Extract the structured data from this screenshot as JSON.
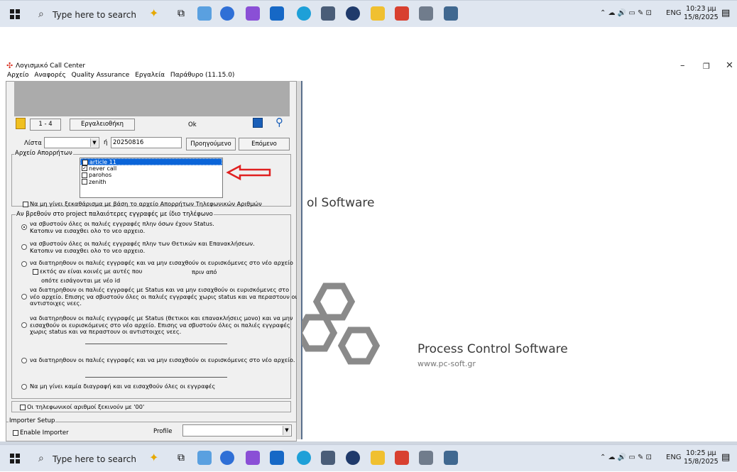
{
  "taskbar": {
    "search_placeholder": "Type here to search",
    "lang": "ENG",
    "top_time": "10:23 μμ",
    "top_date": "15/8/2025",
    "bottom_time": "10:25 μμ",
    "bottom_date": "15/8/2025"
  },
  "window": {
    "title": "Λογισμικό Call Center",
    "menu": [
      "Αρχείο",
      "Αναφορές",
      "Quality Assurance",
      "Εργαλεία",
      "Παράθυρο (11.15.0)"
    ]
  },
  "toolbar": {
    "record_range": "1 - 4",
    "tools_button": "Εργαλειοθήκη",
    "status": "Ok"
  },
  "list_row": {
    "label": "Λίστα",
    "or": "ή",
    "date_value": "20250816",
    "prev_button": "Προηγούμενο",
    "next_button": "Επόμενο"
  },
  "archive_group": {
    "title": "Αρχείο Απορρήτων",
    "items": [
      {
        "label": "article 11",
        "checked": true
      },
      {
        "label": "never call",
        "checked": true
      },
      {
        "label": "parohos",
        "checked": false
      },
      {
        "label": "zenith",
        "checked": false
      }
    ],
    "no_clean_checkbox": "Να μη γίνει ξεκαθάρισμα με βάση το αρχείο Απορρήτων Τηλεφωνικών Αριθμών"
  },
  "old_records_group": {
    "title": "Αν βρεθούν στο project παλαιότερες εγγραφές με ίδιο τηλέφωνο",
    "opt1": "να σβυστούν όλες οι παλιές εγγραφές πλην όσων έχουν Status.",
    "opt1b": "Κατοπιν να εισαχθει ολο το νεο αρχειο.",
    "opt2": "να σβυστούν όλες οι παλιές εγγραφές πλην των Θετικών και Επανακλήσεων.",
    "opt2b": "Κατοπιν να εισαχθει ολο το νεο αρχειο.",
    "opt3": "να διατηρηθουν οι παλιές εγγραφές και να μην εισαχθούν οι ευρισκόμενες στο νέο αρχείο",
    "opt3_check": "εκτός αν είναι κοινές με αυτές που",
    "opt3_before": "πριν από",
    "opt3c": "οπότε εισάγονται με νέο id",
    "opt4": "να διατηρηθουν οι παλιές εγγραφές με Status και να μην εισαχθούν οι ευρισκόμενες στο",
    "opt4b": "νέο αρχείο. Επισης να σβυστούν όλες οι παλιές εγγραφές χωρις status και να περαστουν οι",
    "opt4c": "αντιστοιχες νεες.",
    "opt5": "να διατηρηθουν οι παλιές εγγραφές με Status (θετικοι και επανακλήσεις μονο) και να μην",
    "opt5b": "εισαχθούν οι ευρισκόμενες στο νέο αρχείο. Επισης να σβυστούν όλες οι παλιές εγγραφές",
    "opt5c": "χωρις status και να περαστουν οι αντιστοιχες νεες.",
    "opt6": "να διατηρηθουν οι παλιές εγγραφές και να μην εισαχθούν οι ευρισκόμενες στο νέο αρχείο.",
    "opt7": "Να μη γίνει καμία διαγραφή και να εισαχθούν όλες οι εγγραφές"
  },
  "zero_prefix_checkbox": "Οι τηλεφωνικοί αριθμοί ξεκινούν με '00'",
  "importer": {
    "title": "Importer Setup",
    "enable": "Enable Importer",
    "profile_label": "Profile"
  },
  "splash": {
    "partial_text": "ol Software",
    "company": "Process Control Software",
    "url": "www.pc-soft.gr"
  },
  "colors": {
    "taskbar": "#dfe6f0",
    "selection": "#0a64d8",
    "arrow": "#e02020"
  }
}
